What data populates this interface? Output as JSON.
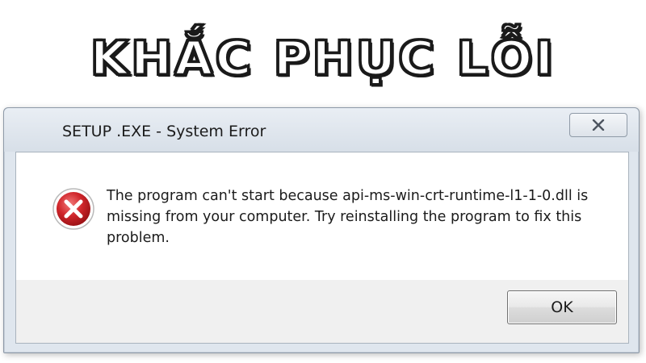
{
  "banner": {
    "text": "KHẮC PHỤC LỖI"
  },
  "dialog": {
    "title": "SETUP .EXE - System Error",
    "close_icon": "close-icon",
    "icon": "error-icon",
    "message": "The program can't start because api-ms-win-crt-runtime-l1-1-0.dll is missing from your computer. Try reinstalling the program to fix this problem.",
    "ok_label": "OK"
  },
  "colors": {
    "error_red": "#d0262b",
    "frame": "#dfe6ee",
    "client_bg": "#f0f0f0"
  }
}
